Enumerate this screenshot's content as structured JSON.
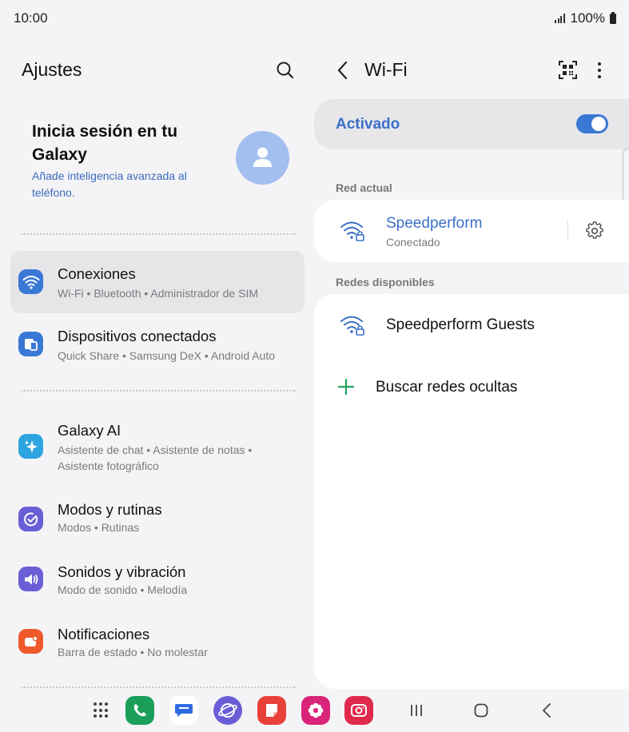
{
  "status_bar": {
    "time": "10:00",
    "battery": "100%"
  },
  "left": {
    "title": "Ajustes",
    "account": {
      "title": "Inicia sesión en tu Galaxy",
      "subtitle": "Añade inteligencia avanzada al teléfono."
    },
    "menu": [
      {
        "title": "Conexiones",
        "subtitle": "Wi-Fi  •  Bluetooth  •  Administrador de SIM",
        "icon": "wifi-icon",
        "color": "#3a78d6",
        "selected": true
      },
      {
        "title": "Dispositivos conectados",
        "subtitle": "Quick Share  •  Samsung DeX  •  Android Auto",
        "icon": "devices-icon",
        "color": "#3a78d6"
      },
      {
        "title": "Galaxy AI",
        "subtitle": "Asistente de chat  •  Asistente de notas  •  Asistente fotográfico",
        "icon": "sparkle-icon",
        "color": "#2ea5e0"
      },
      {
        "title": "Modos y rutinas",
        "subtitle": "Modos  •  Rutinas",
        "icon": "check-circle-icon",
        "color": "#6a5ed6"
      },
      {
        "title": "Sonidos y vibración",
        "subtitle": "Modo de sonido  •  Melodía",
        "icon": "speaker-icon",
        "color": "#6a5ed6"
      },
      {
        "title": "Notificaciones",
        "subtitle": "Barra de estado  •  No molestar",
        "icon": "notification-icon",
        "color": "#ef5a2a"
      }
    ]
  },
  "right": {
    "title": "Wi-Fi",
    "toggle_label": "Activado",
    "toggle_on": true,
    "current_section": "Red actual",
    "current_network": {
      "name": "Speedperform",
      "status": "Conectado"
    },
    "available_section": "Redes disponibles",
    "available_networks": [
      {
        "name": "Speedperform Guests"
      }
    ],
    "add_hidden": "Buscar redes ocultas"
  },
  "colors": {
    "accent": "#3b6fc6",
    "toggle": "#3a78d6",
    "add": "#1fa35a"
  },
  "dock": {
    "apps": [
      {
        "name": "phone-app-icon",
        "color": "#1a9e5a"
      },
      {
        "name": "messages-app-icon",
        "color": "#ffffff"
      },
      {
        "name": "internet-app-icon",
        "color": "#6a5ed6"
      },
      {
        "name": "notes-app-icon",
        "color": "#e8413a"
      },
      {
        "name": "gallery-app-icon",
        "color": "#d9247a"
      },
      {
        "name": "camera-app-icon",
        "color": "#e02a4c"
      }
    ]
  }
}
